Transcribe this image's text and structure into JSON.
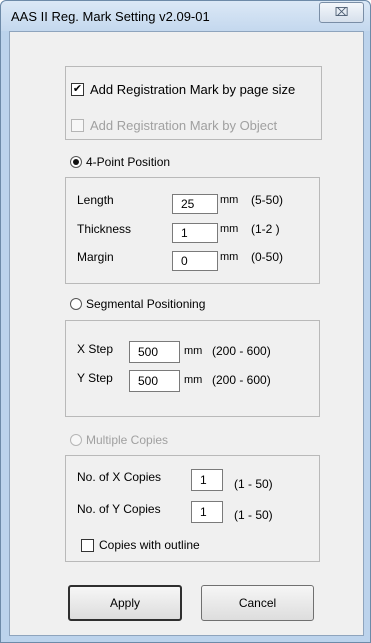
{
  "window": {
    "title": "AAS II Reg. Mark Setting v2.09-01",
    "close_symbol": "⌧"
  },
  "mark_mode": {
    "by_page_size": {
      "label": "Add Registration Mark by page size",
      "checked": true,
      "enabled": true
    },
    "by_object": {
      "label": "Add Registration Mark by Object",
      "checked": false,
      "enabled": false
    }
  },
  "four_point": {
    "label": "4-Point Position",
    "selected": true,
    "length": {
      "label": "Length",
      "value": "25",
      "unit": "mm",
      "range": "(5-50)"
    },
    "thickness": {
      "label": "Thickness",
      "value": "1",
      "unit": "mm",
      "range": "(1-2 )"
    },
    "margin": {
      "label": "Margin",
      "value": "0",
      "unit": "mm",
      "range": "(0-50)"
    }
  },
  "segmental": {
    "label": "Segmental Positioning",
    "selected": false,
    "x_step": {
      "label": "X Step",
      "value": "500",
      "unit": "mm",
      "range": "(200 - 600)"
    },
    "y_step": {
      "label": "Y Step",
      "value": "500",
      "unit": "mm",
      "range": "(200 - 600)"
    }
  },
  "multiple": {
    "label": "Multiple Copies",
    "selected": false,
    "enabled": false,
    "x_copies": {
      "label": "No. of X Copies",
      "value": "1",
      "range": "(1 - 50)"
    },
    "y_copies": {
      "label": "No. of Y Copies",
      "value": "1",
      "range": "(1 - 50)"
    },
    "outline": {
      "label": "Copies with outline",
      "checked": false
    }
  },
  "buttons": {
    "apply": "Apply",
    "cancel": "Cancel"
  },
  "colors": {
    "frame": "#bcd3ec",
    "client": "#f0f0f0",
    "disabled_text": "#a0a0a0"
  }
}
